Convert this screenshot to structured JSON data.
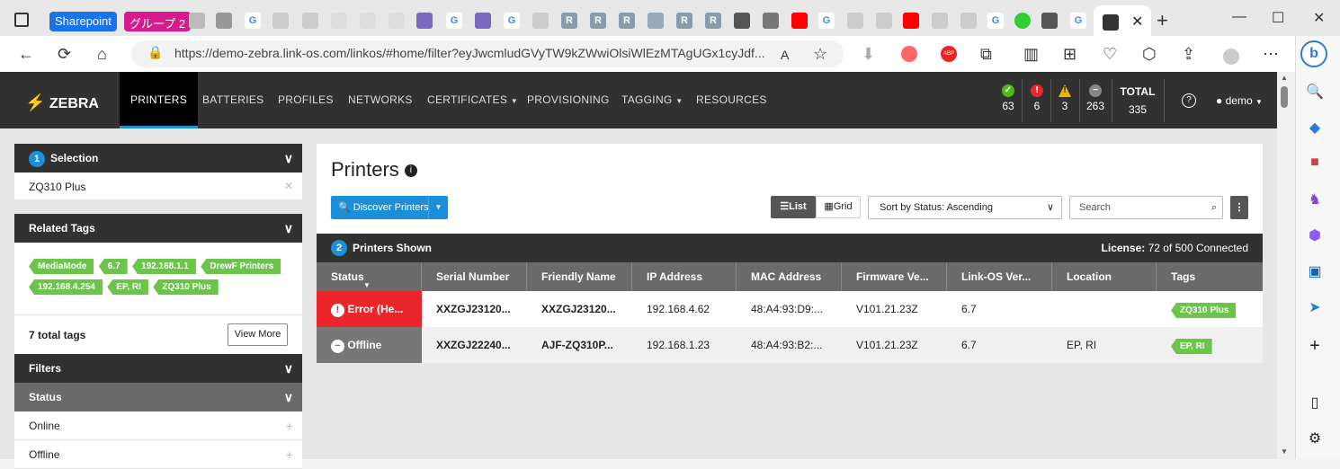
{
  "browser": {
    "tab_groups": [
      {
        "label": "Sharepoint",
        "color": "#1a73e8"
      },
      {
        "label": "グループ 2",
        "color": "#d81b8c"
      }
    ],
    "url": "https://demo-zebra.link-os.com/linkos/#home/filter?eyJwcmludGVyTW9kZWwiOlsiWlEzMTAgUGx1cyJdf..."
  },
  "app": {
    "brand": "ZEBRA",
    "nav": [
      "PRINTERS",
      "BATTERIES",
      "PROFILES",
      "NETWORKS",
      "CERTIFICATES",
      "PROVISIONING",
      "TAGGING",
      "RESOURCES"
    ],
    "status_counts": {
      "ok": "63",
      "error": "6",
      "warning": "3",
      "offline": "263"
    },
    "total_label": "TOTAL",
    "total_value": "335",
    "user": "demo"
  },
  "left": {
    "selection_num": "1",
    "selection_label": "Selection",
    "selection_value": "ZQ310 Plus",
    "related_tags_label": "Related Tags",
    "tags": [
      "MediaMode",
      "6.7",
      "192.168.1.1",
      "DrewF Printers",
      "192.168.4.254",
      "EP, RI",
      "ZQ310 Plus"
    ],
    "total_tags": "7 total tags",
    "view_more": "View More",
    "filters_label": "Filters",
    "status_label": "Status",
    "status_items": [
      "Online",
      "Offline"
    ]
  },
  "main": {
    "title": "Printers",
    "discover": "Discover Printers",
    "list": "List",
    "grid": "Grid",
    "sort": "Sort by Status: Ascending",
    "search_placeholder": "Search",
    "shown_num": "2",
    "shown_label": "Printers Shown",
    "license_label": "License:",
    "license_value": "72 of 500 Connected",
    "columns": [
      "Status",
      "Serial Number",
      "Friendly Name",
      "IP Address",
      "MAC Address",
      "Firmware Ve...",
      "Link-OS Ver...",
      "Location",
      "Tags"
    ],
    "rows": [
      {
        "status": "Error (He...",
        "serial": "XXZGJ23120...",
        "friendly": "XXZGJ23120...",
        "ip": "192.168.4.62",
        "mac": "48:A4:93:D9:...",
        "fw": "V101.21.23Z",
        "linkos": "6.7",
        "location": "",
        "tag": "ZQ310 Plus",
        "status_color": "#e8262c"
      },
      {
        "status": "Offline",
        "serial": "XXZGJ22240...",
        "friendly": "AJF-ZQ310P...",
        "ip": "192.168.1.23",
        "mac": "48:A4:93:B2:...",
        "fw": "V101.21.23Z",
        "linkos": "6.7",
        "location": "EP, RI",
        "tag": "EP, RI",
        "status_color": "#777777"
      }
    ]
  },
  "colors": {
    "accent": "#1b8fd8",
    "tag_green": "#6bc54a",
    "dark": "#313131"
  }
}
